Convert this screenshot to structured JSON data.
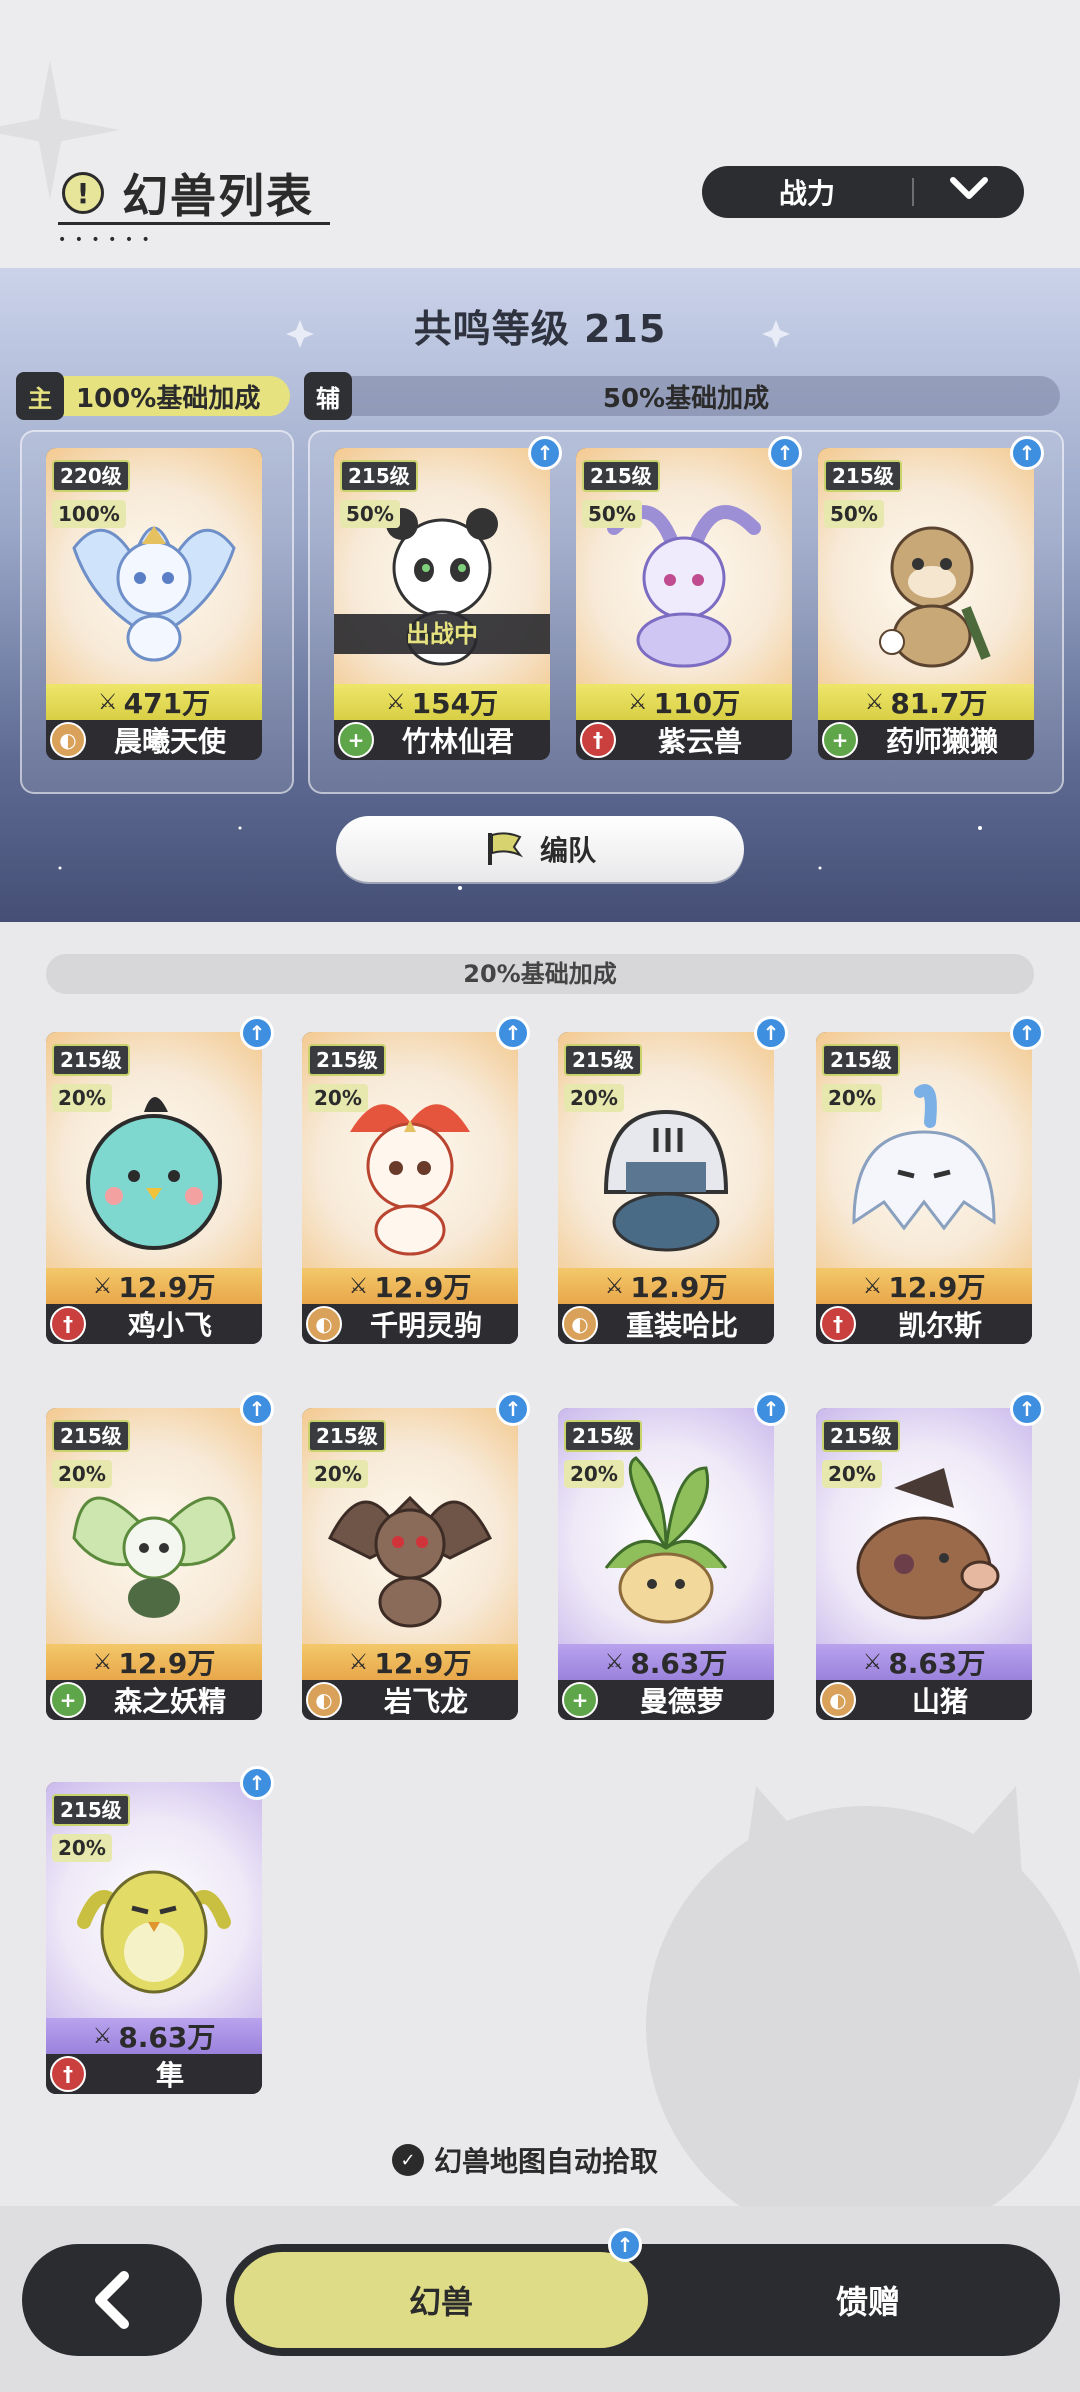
{
  "header": {
    "title": "幻兽列表",
    "title_icon": "!",
    "sort": {
      "label": "战力",
      "arrow": "chevron-down-icon"
    }
  },
  "resonance": {
    "title": "共鸣等级 215",
    "main_tag": "主",
    "main_bonus": "100%基础加成",
    "sub_tag": "辅",
    "sub_bonus": "50%基础加成",
    "formation_button": "编队"
  },
  "main_beast": {
    "level": "220级",
    "pct": "100%",
    "power": "471万",
    "name": "晨曦天使",
    "role": "defense",
    "role_icon": "shield-icon"
  },
  "sub_beasts": [
    {
      "level": "215级",
      "pct": "50%",
      "power": "154万",
      "name": "竹林仙君",
      "role": "support",
      "deployed": "出战中"
    },
    {
      "level": "215级",
      "pct": "50%",
      "power": "110万",
      "name": "紫云兽",
      "role": "attack"
    },
    {
      "level": "215级",
      "pct": "50%",
      "power": "81.7万",
      "name": "药师獭獭",
      "role": "support"
    }
  ],
  "list": {
    "bonus": "20%基础加成",
    "beasts": [
      {
        "level": "215级",
        "pct": "20%",
        "power": "12.9万",
        "name": "鸡小飞",
        "role": "attack"
      },
      {
        "level": "215级",
        "pct": "20%",
        "power": "12.9万",
        "name": "千明灵驹",
        "role": "defense"
      },
      {
        "level": "215级",
        "pct": "20%",
        "power": "12.9万",
        "name": "重装哈比",
        "role": "defense"
      },
      {
        "level": "215级",
        "pct": "20%",
        "power": "12.9万",
        "name": "凯尔斯",
        "role": "attack"
      },
      {
        "level": "215级",
        "pct": "20%",
        "power": "12.9万",
        "name": "森之妖精",
        "role": "support"
      },
      {
        "level": "215级",
        "pct": "20%",
        "power": "12.9万",
        "name": "岩飞龙",
        "role": "defense"
      },
      {
        "level": "215级",
        "pct": "20%",
        "power": "8.63万",
        "name": "曼德萝",
        "role": "support"
      },
      {
        "level": "215级",
        "pct": "20%",
        "power": "8.63万",
        "name": "山猪",
        "role": "defense"
      },
      {
        "level": "215级",
        "pct": "20%",
        "power": "8.63万",
        "name": "隼",
        "role": "attack"
      }
    ]
  },
  "auto_pick": "幻兽地图自动拾取",
  "bottom_nav": {
    "back_icon": "back-arrow-icon",
    "tabs": [
      {
        "label": "幻兽",
        "active": true
      },
      {
        "label": "馈赠",
        "active": false
      }
    ]
  },
  "colors": {
    "accent": "#e6e27f",
    "dark": "#2c2d31",
    "upgrade_badge": "#3f8fe0",
    "attack": "#c9403f",
    "support": "#5fa64a",
    "defense": "#d9a15a"
  }
}
